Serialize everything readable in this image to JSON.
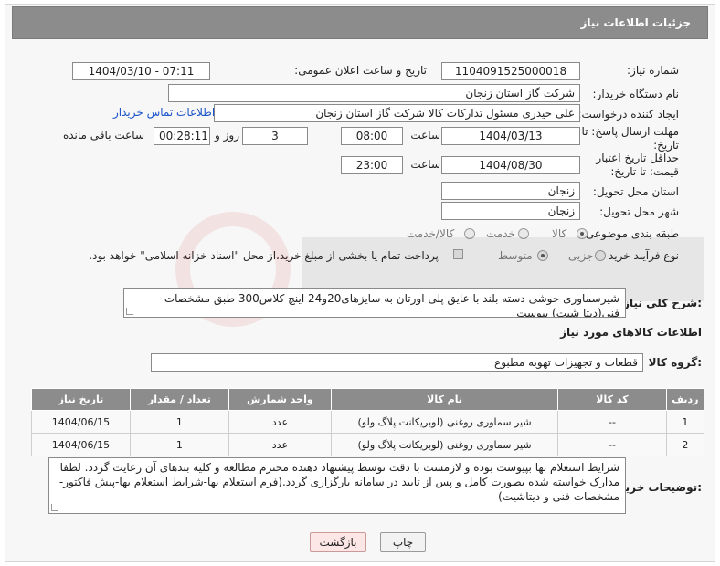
{
  "header": {
    "title": "جزئیات اطلاعات نیاز"
  },
  "fields": {
    "need_number_label": "شماره نیاز:",
    "need_number": "1104091525000018",
    "announce_label": "تاریخ و ساعت اعلان عمومی:",
    "announce_value": "1404/03/10 - 07:11",
    "buyer_label": "نام دستگاه خریدار:",
    "buyer_value": "شرکت گاز استان زنجان",
    "creator_label": "ایجاد کننده درخواست:",
    "creator_value": "علی حیدری مسئول تدارکات کالا شرکت گاز استان زنجان",
    "contact_link": "اطلاعات تماس خریدار",
    "reply_deadline_label": "مهلت ارسال پاسخ: تا تاریخ:",
    "reply_date": "1404/03/13",
    "time_label": "ساعت",
    "reply_time": "08:00",
    "days_value": "3",
    "days_label": "روز و",
    "remaining_time": "00:28:11",
    "remaining_label": "ساعت باقی مانده",
    "price_deadline_label": "حداقل تاریخ اعتبار قیمت: تا تاریخ:",
    "price_date": "1404/08/30",
    "price_time_label": "ساعت",
    "price_time": "23:00",
    "province_label": "استان محل تحویل:",
    "province_value": "زنجان",
    "city_label": "شهر محل تحویل:",
    "city_value": "زنجان",
    "category_label": "طبقه بندی موضوعی:",
    "category_options": [
      "کالا",
      "خدمت",
      "کالا/خدمت"
    ],
    "process_label": "نوع فرآیند خرید :",
    "process_options": [
      "جزیی",
      "متوسط"
    ],
    "payment_note": "پرداخت تمام یا بخشی از مبلغ خرید،از محل \"اسناد خزانه اسلامی\" خواهد بود."
  },
  "description": {
    "label": "شرح کلی نیاز:",
    "text": "شیرسماوری جوشی دسته بلند با عایق پلی اورتان به سایزهای20و24 اینچ کلاس300 طبق مشخصات فنی(دیتا شیت) پیوست"
  },
  "goods": {
    "section_title": "اطلاعات کالاهای مورد نیاز",
    "group_label": "گروه کالا:",
    "group_value": "قطعات و تجهیزات تهویه مطبوع",
    "columns": [
      "ردیف",
      "کد کالا",
      "نام کالا",
      "واحد شمارش",
      "تعداد / مقدار",
      "تاریخ نیاز"
    ],
    "rows": [
      [
        "1",
        "--",
        "شیر سماوری روغنی (لوبریکانت پلاگ ولو)",
        "عدد",
        "1",
        "1404/06/15"
      ],
      [
        "2",
        "--",
        "شیر سماوری روغنی (لوبریکانت پلاگ ولو)",
        "عدد",
        "1",
        "1404/06/15"
      ]
    ]
  },
  "buyer_notes": {
    "label": "توضیحات خریدار:",
    "text": "شرایط استعلام بها بپیوست بوده و لازمست با دقت توسط پیشنهاد دهنده محترم مطالعه و کلیه بندهای آن رعایت گردد. لطفا مدارک خواسته شده بصورت کامل و پس از تایید در سامانه بارگزاری گردد.(فرم استعلام بها-شرایط استعلام بها-پیش فاکتور-مشخصات فنی و دیتاشیت)"
  },
  "buttons": {
    "print": "چاپ",
    "back": "بازگشت"
  }
}
